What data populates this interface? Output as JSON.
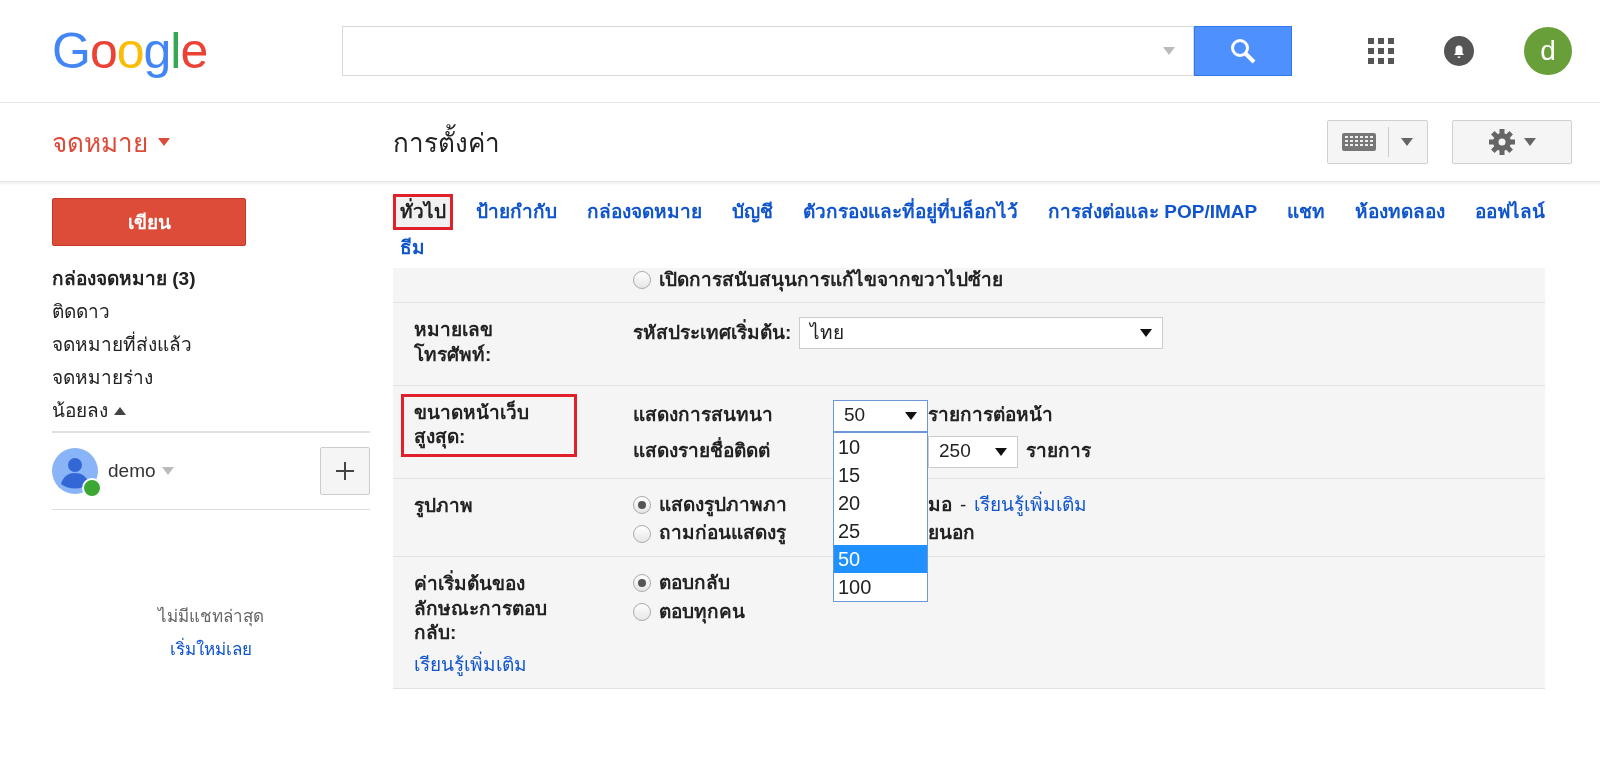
{
  "header": {
    "logo": "Google",
    "avatar": {
      "letter": "d"
    }
  },
  "toolbar": {
    "app_menu": "จดหมาย",
    "title": "การตั้งค่า"
  },
  "sidebar": {
    "compose": "เขียน",
    "items": [
      {
        "label": "กล่องจดหมาย (3)",
        "selected": true
      },
      {
        "label": "ติดดาว",
        "selected": false
      },
      {
        "label": "จดหมายที่ส่งแล้ว",
        "selected": false
      },
      {
        "label": "จดหมายร่าง",
        "selected": false
      }
    ],
    "less": "น้อยลง",
    "chat": {
      "user": "demo",
      "online": true
    },
    "empty_chat": "ไม่มีแชทล่าสุด",
    "start_link": "เริ่มใหม่เลย"
  },
  "tabs": [
    {
      "label": "ทั่วไป",
      "selected": true,
      "highlighted": true
    },
    {
      "label": "ป้ายกำกับ",
      "selected": false,
      "highlighted": false
    },
    {
      "label": "กล่องจดหมาย",
      "selected": false,
      "highlighted": false
    },
    {
      "label": "บัญชี",
      "selected": false,
      "highlighted": false
    },
    {
      "label": "ตัวกรองและที่อยู่ที่บล็อกไว้",
      "selected": false,
      "highlighted": false
    },
    {
      "label": "การส่งต่อและ POP/IMAP",
      "selected": false,
      "highlighted": false
    },
    {
      "label": "แชท",
      "selected": false,
      "highlighted": false
    },
    {
      "label": "ห้องทดลอง",
      "selected": false,
      "highlighted": false
    },
    {
      "label": "ออฟไลน์",
      "selected": false,
      "highlighted": false
    },
    {
      "label": "ธีม",
      "selected": false,
      "highlighted": false
    }
  ],
  "settings": [
    {
      "kind": "radios",
      "options": [
        {
          "parts": [
            "เปิดการสนับสนุนการแก้ไขจากขวาไปซ้าย"
          ],
          "selected": false
        }
      ]
    },
    {
      "kind": "select",
      "label": "หมายเลขโทรศัพท์:",
      "highlighted": false,
      "prefix": "รหัสประเทศเริ่มต้น:",
      "value": "ไทย"
    },
    {
      "kind": "page_size",
      "label": "ขนาดหน้าเว็บสูงสุด:",
      "highlighted": true,
      "conversations": {
        "prefix": "แสดงการสนทนา",
        "value": "50",
        "suffix": "รายการต่อหน้า",
        "options": [
          {
            "label": "10",
            "selected": false
          },
          {
            "label": "15",
            "selected": false
          },
          {
            "label": "20",
            "selected": false
          },
          {
            "label": "25",
            "selected": false
          },
          {
            "label": "50",
            "selected": true
          },
          {
            "label": "100",
            "selected": false
          }
        ]
      },
      "contacts": {
        "prefix": "แสดงรายชื่อติดต่",
        "value": "250",
        "suffix": "รายการ"
      }
    },
    {
      "kind": "radios",
      "label": "รูปภาพ",
      "highlighted": false,
      "options": [
        {
          "parts": [
            "แสดงรูปภาพภา",
            "มอ"
          ],
          "separator": "-",
          "link": "เรียนรู้เพิ่มเติม",
          "selected": true
        },
        {
          "parts": [
            "ถามก่อนแสดงรู",
            "ยนอก"
          ],
          "selected": false
        }
      ]
    },
    {
      "kind": "radios",
      "label": "ค่าเริ่มต้นของลักษณะการตอบกลับ:",
      "highlighted": false,
      "label_link": "เรียนรู้เพิ่มเติม",
      "options": [
        {
          "parts": [
            "ตอบกลับ"
          ],
          "selected": true
        },
        {
          "parts": [
            "ตอบทุกคน"
          ],
          "selected": false
        }
      ]
    }
  ]
}
